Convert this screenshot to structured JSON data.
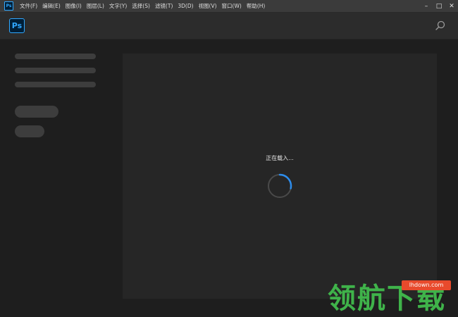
{
  "app": {
    "title_icon": "photoshop-icon",
    "logo_text": "Ps",
    "brand_color": "#31a8ff"
  },
  "menu": [
    {
      "label": "文件(F)"
    },
    {
      "label": "编辑(E)"
    },
    {
      "label": "图像(I)"
    },
    {
      "label": "图层(L)"
    },
    {
      "label": "文字(Y)"
    },
    {
      "label": "选择(S)"
    },
    {
      "label": "滤镜(T)"
    },
    {
      "label": "3D(D)"
    },
    {
      "label": "视图(V)"
    },
    {
      "label": "窗口(W)"
    },
    {
      "label": "帮助(H)"
    }
  ],
  "window_controls": {
    "minimize": "–",
    "maximize": "□",
    "close": "✕"
  },
  "main": {
    "loading_text": "正在载入..."
  },
  "watermark": {
    "text": "领航下载",
    "url": "lhdown.com",
    "text_color": "#3fb34a",
    "url_bg": "#e84a2c"
  }
}
